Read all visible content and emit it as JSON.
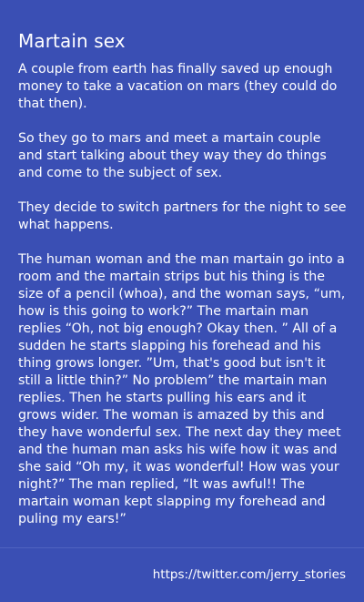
{
  "post": {
    "title": "Martain sex",
    "paragraphs": [
      "A couple from earth has finally saved up enough money to take a vacation on mars (they could do that then).",
      "So they go to mars and meet a martain couple and start talking about they way they do things and come to the subject of sex.",
      "They decide to switch partners for the night to see what happens.",
      "The human woman and the man martain go into a room and the martain strips but his thing is the size of a pencil (whoa), and the woman says, “um, how is this going to work?” The martain man replies “Oh, not big enough? Okay then. ” All of a sudden he starts slapping his forehead and his thing grows longer. ”Um, that's good but isn't it still a little thin?” No problem” the martain man replies. Then he starts pulling his ears and it grows wider. The woman is amazed by this and they have wonderful sex. The next day they meet and the human man asks his wife how it was and she said “Oh my, it was wonderful! How was your night?” The man replied, “It was awful!! The martain woman kept slapping my forehead and puling my ears!”"
    ],
    "footer_link": "https://twitter.com/jerry_stories"
  },
  "colors": {
    "background": "#3a4fb4",
    "text": "#ffffff",
    "divider": "#5063c0"
  }
}
